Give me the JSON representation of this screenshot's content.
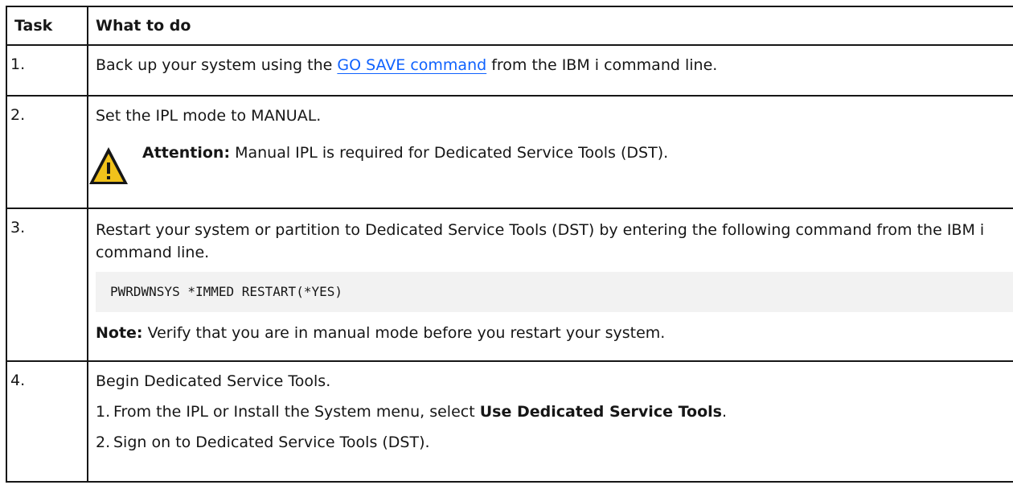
{
  "table": {
    "headers": {
      "task": "Task",
      "what": "What to do"
    },
    "rows": [
      {
        "num": "1.",
        "text_before": "Back up your system using the ",
        "link": "GO SAVE command",
        "text_after": " from the IBM i command line."
      },
      {
        "num": "2.",
        "text": "Set the IPL mode to MANUAL.",
        "attention_label": "Attention:",
        "attention_text": " Manual IPL is required for Dedicated Service Tools (DST)."
      },
      {
        "num": "3.",
        "text": "Restart your system or partition to Dedicated Service Tools (DST) by entering the following command from the IBM i command line.",
        "code": "PWRDWNSYS *IMMED RESTART(*YES)",
        "note_label": "Note:",
        "note_text": " Verify that you are in manual mode before you restart your system."
      },
      {
        "num": "4.",
        "text": "Begin Dedicated Service Tools.",
        "steps": [
          {
            "num": "1.",
            "before": " From the IPL or Install the System menu, select ",
            "bold": "Use Dedicated Service Tools",
            "after": "."
          },
          {
            "num": "2.",
            "before": " Sign on to Dedicated Service Tools (DST).",
            "bold": "",
            "after": ""
          }
        ]
      }
    ]
  },
  "icons": {
    "warning": "warning-triangle-icon"
  },
  "colors": {
    "link": "#0f62fe",
    "warning_fill": "#f1c21b",
    "code_bg": "#f2f2f2",
    "border": "#161616"
  }
}
